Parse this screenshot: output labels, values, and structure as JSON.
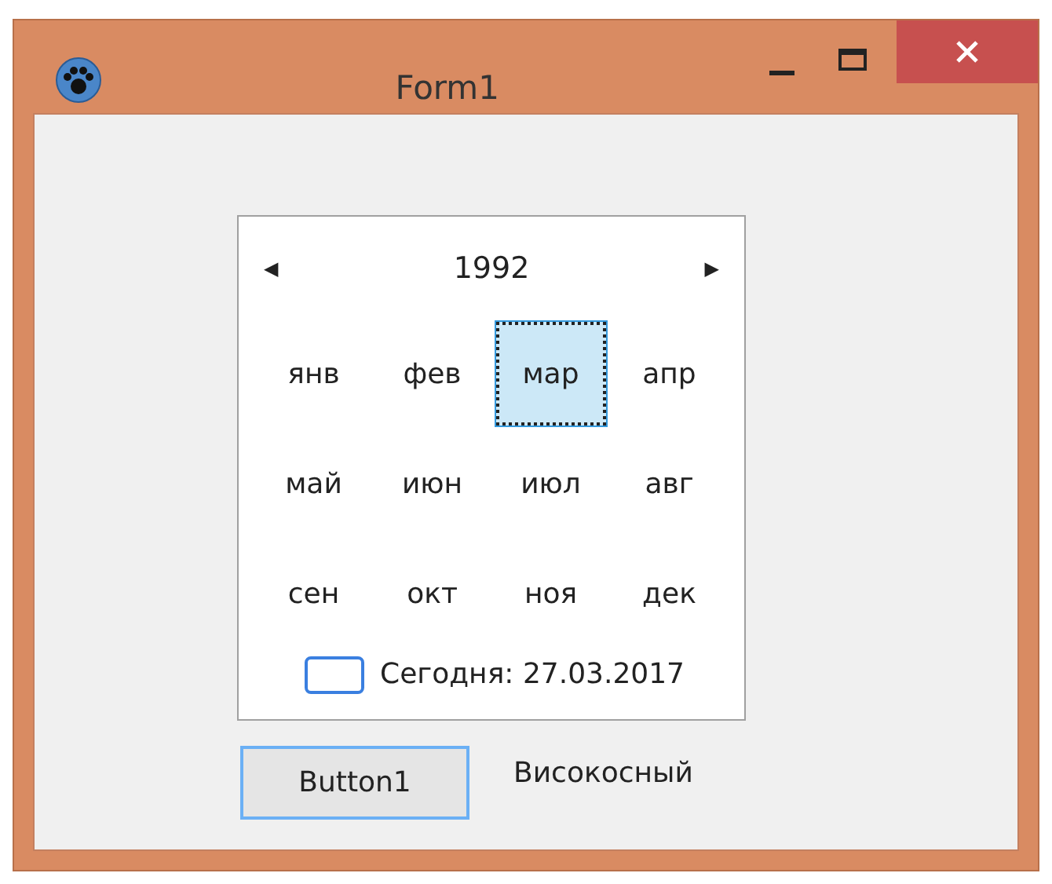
{
  "window": {
    "title": "Form1"
  },
  "calendar": {
    "year": "1992",
    "prev": "◀",
    "next": "▶",
    "months": [
      {
        "label": "янв",
        "selected": false
      },
      {
        "label": "фев",
        "selected": false
      },
      {
        "label": "мар",
        "selected": true
      },
      {
        "label": "апр",
        "selected": false
      },
      {
        "label": "май",
        "selected": false
      },
      {
        "label": "июн",
        "selected": false
      },
      {
        "label": "июл",
        "selected": false
      },
      {
        "label": "авг",
        "selected": false
      },
      {
        "label": "сен",
        "selected": false
      },
      {
        "label": "окт",
        "selected": false
      },
      {
        "label": "ноя",
        "selected": false
      },
      {
        "label": "дек",
        "selected": false
      }
    ],
    "today": "Сегодня: 27.03.2017"
  },
  "button": "Button1",
  "label": "Високосный"
}
